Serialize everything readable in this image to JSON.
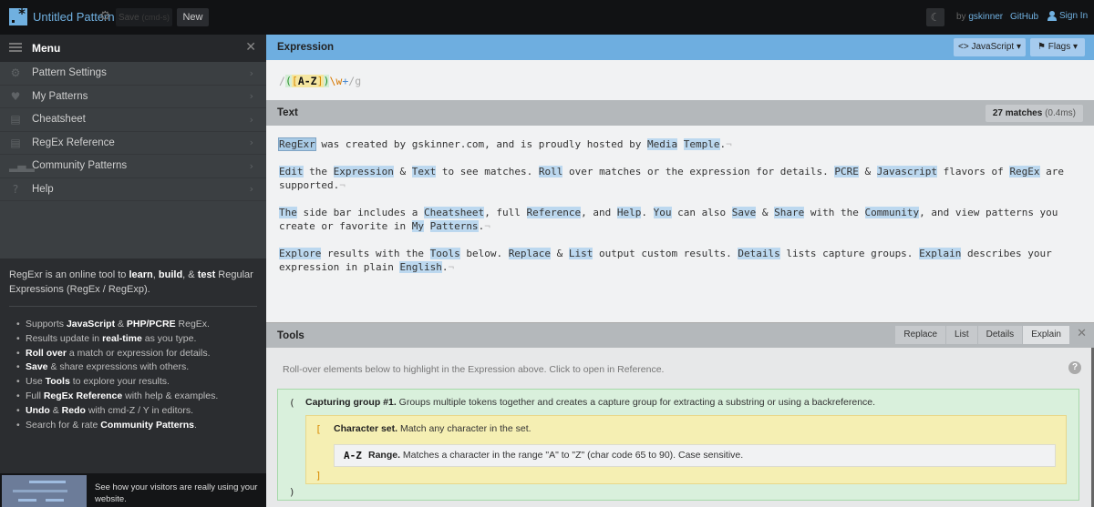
{
  "topbar": {
    "title": "Untitled Pattern",
    "save_label": "Save",
    "save_hint": "(cmd-s)",
    "new_label": "New",
    "by_prefix": "by",
    "author": "gskinner",
    "github_label": "GitHub",
    "signin_label": "Sign In"
  },
  "sidebar": {
    "menu_title": "Menu",
    "items": [
      {
        "label": "Pattern Settings",
        "icon": "gear-icon"
      },
      {
        "label": "My Patterns",
        "icon": "heart-icon"
      },
      {
        "label": "Cheatsheet",
        "icon": "document-icon"
      },
      {
        "label": "RegEx Reference",
        "icon": "book-icon"
      },
      {
        "label": "Community Patterns",
        "icon": "community-icon"
      },
      {
        "label": "Help",
        "icon": "help-icon"
      }
    ],
    "intro": {
      "p1": "RegExr is an online tool to ",
      "b1": "learn",
      "p2": ", ",
      "b2": "build",
      "p3": ", & ",
      "b3": "test",
      "p4": " Regular Expressions (RegEx / RegExp)."
    },
    "features": [
      {
        "pre": "Supports ",
        "b1": "JavaScript",
        "mid": " & ",
        "b2": "PHP/PCRE",
        "post": " RegEx."
      },
      {
        "pre": "Results update in ",
        "b1": "real-time",
        "mid": "",
        "b2": "",
        "post": " as you type."
      },
      {
        "pre": "",
        "b1": "Roll over",
        "mid": "",
        "b2": "",
        "post": " a match or expression for details."
      },
      {
        "pre": "",
        "b1": "Save",
        "mid": "",
        "b2": "",
        "post": " & share expressions with others."
      },
      {
        "pre": "Use ",
        "b1": "Tools",
        "mid": "",
        "b2": "",
        "post": " to explore your results."
      },
      {
        "pre": "Full ",
        "b1": "RegEx Reference",
        "mid": "",
        "b2": "",
        "post": " with help & examples."
      },
      {
        "pre": "",
        "b1": "Undo",
        "mid": " & ",
        "b2": "Redo",
        "post": " with cmd-Z / Y in editors."
      },
      {
        "pre": "Search for & rate ",
        "b1": "Community Patterns",
        "mid": "",
        "b2": "",
        "post": "."
      }
    ],
    "ad_text": "See how your visitors are really using your website."
  },
  "expression": {
    "header": "Expression",
    "flavor_label": "JavaScript",
    "flags_label": "Flags",
    "tokens": {
      "open_slash": "/",
      "group_open": "(",
      "set_open": "[",
      "range": "A-Z",
      "set_close": "]",
      "group_close": ")",
      "escape": "\\w",
      "quantifier": "+",
      "close_slash": "/",
      "flags": "g"
    }
  },
  "text": {
    "header": "Text",
    "match_count": "27 matches",
    "match_time": "(0.4ms)",
    "paragraphs": [
      [
        {
          "t": "RegExr",
          "m": true
        },
        {
          "t": " was created by gskinner.com, and is proudly hosted by "
        },
        {
          "t": "Media",
          "m": true
        },
        {
          "t": " "
        },
        {
          "t": "Temple",
          "m": true
        },
        {
          "t": "."
        }
      ],
      [
        {
          "t": "Edit",
          "m": true
        },
        {
          "t": " the "
        },
        {
          "t": "Expression",
          "m": true
        },
        {
          "t": " & "
        },
        {
          "t": "Text",
          "m": true
        },
        {
          "t": " to see matches. "
        },
        {
          "t": "Roll",
          "m": true
        },
        {
          "t": " over matches or the expression for details. "
        },
        {
          "t": "PCRE",
          "m": true
        },
        {
          "t": " & "
        },
        {
          "t": "Javascript",
          "m": true
        },
        {
          "t": " flavors of "
        },
        {
          "t": "RegEx",
          "m": true
        },
        {
          "t": " are supported."
        }
      ],
      [
        {
          "t": "The",
          "m": true
        },
        {
          "t": " side bar includes a "
        },
        {
          "t": "Cheatsheet",
          "m": true
        },
        {
          "t": ", full "
        },
        {
          "t": "Reference",
          "m": true
        },
        {
          "t": ", and "
        },
        {
          "t": "Help",
          "m": true
        },
        {
          "t": ". "
        },
        {
          "t": "You",
          "m": true
        },
        {
          "t": " can also "
        },
        {
          "t": "Save",
          "m": true
        },
        {
          "t": " & "
        },
        {
          "t": "Share",
          "m": true
        },
        {
          "t": " with the "
        },
        {
          "t": "Community",
          "m": true
        },
        {
          "t": ", and view patterns you create or favorite in "
        },
        {
          "t": "My",
          "m": true
        },
        {
          "t": " "
        },
        {
          "t": "Patterns",
          "m": true
        },
        {
          "t": "."
        }
      ],
      [
        {
          "t": "Explore",
          "m": true
        },
        {
          "t": " results with the "
        },
        {
          "t": "Tools",
          "m": true
        },
        {
          "t": " below. "
        },
        {
          "t": "Replace",
          "m": true
        },
        {
          "t": " & "
        },
        {
          "t": "List",
          "m": true
        },
        {
          "t": " output custom results. "
        },
        {
          "t": "Details",
          "m": true
        },
        {
          "t": " lists capture groups. "
        },
        {
          "t": "Explain",
          "m": true
        },
        {
          "t": " describes your expression in plain "
        },
        {
          "t": "English",
          "m": true
        },
        {
          "t": "."
        }
      ]
    ]
  },
  "tools": {
    "header": "Tools",
    "tabs": [
      "Replace",
      "List",
      "Details",
      "Explain"
    ],
    "active_tab": "Explain",
    "hint": "Roll-over elements below to highlight in the Expression above. Click to open in Reference.",
    "explain": {
      "group": {
        "open": "(",
        "close": ")",
        "title": "Capturing group #1.",
        "desc": " Groups multiple tokens together and creates a capture group for extracting a substring or using a backreference."
      },
      "set": {
        "open": "[",
        "close": "]",
        "title": "Character set.",
        "desc": " Match any character in the set."
      },
      "range": {
        "token": "A-Z",
        "title": "Range.",
        "desc": " Matches a character in the range \"A\" to \"Z\" (char code 65 to 90). Case sensitive."
      }
    }
  },
  "colors": {
    "accent": "#70b0e0",
    "match_highlight": "#bcd8ef",
    "group_bg": "#d9f0dc",
    "set_bg": "#f5efb3"
  }
}
